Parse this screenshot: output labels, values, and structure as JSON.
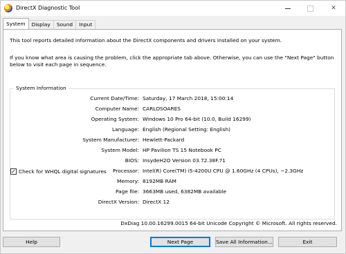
{
  "window": {
    "title": "DirectX Diagnostic Tool",
    "controls": {
      "close": "✕"
    }
  },
  "tabs": [
    "System",
    "Display",
    "Sound",
    "Input"
  ],
  "intro": {
    "line1": "This tool reports detailed information about the DirectX components and drivers installed on your system.",
    "line2": "If you know what area is causing the problem, click the appropriate tab above.  Otherwise, you can use the \"Next Page\" button below to visit each page in sequence."
  },
  "system_info": {
    "group_title": "System Information",
    "rows": [
      {
        "label": "Current Date/Time:",
        "value": "Saturday, 17 March 2018, 15:00:14"
      },
      {
        "label": "Computer Name:",
        "value": "CARLOSOARES"
      },
      {
        "label": "Operating System:",
        "value": "Windows 10 Pro 64-bit (10.0, Build 16299)"
      },
      {
        "label": "Language:",
        "value": "English (Regional Setting: English)"
      },
      {
        "label": "System Manufacturer:",
        "value": "Hewlett-Packard"
      },
      {
        "label": "System Model:",
        "value": "HP Pavilion TS 15 Notebook PC"
      },
      {
        "label": "BIOS:",
        "value": "InsydeH2O Version 03.72.38F.71"
      },
      {
        "label": "Processor:",
        "value": "Intel(R) Core(TM) i5-4200U CPU @ 1.60GHz (4 CPUs), ~2.3GHz"
      },
      {
        "label": "Memory:",
        "value": "8192MB RAM"
      },
      {
        "label": "Page file:",
        "value": "3663MB used, 6382MB available"
      },
      {
        "label": "DirectX Version:",
        "value": "DirectX 12"
      }
    ],
    "whql_label": "Check for WHQL digital signatures",
    "whql_checked": true
  },
  "footer_version": "DxDiag 10.00.16299.0015 64-bit Unicode  Copyright © Microsoft. All rights reserved.",
  "buttons": {
    "help": "Help",
    "next_page": "Next Page",
    "save_all": "Save All Information...",
    "exit": "Exit"
  }
}
